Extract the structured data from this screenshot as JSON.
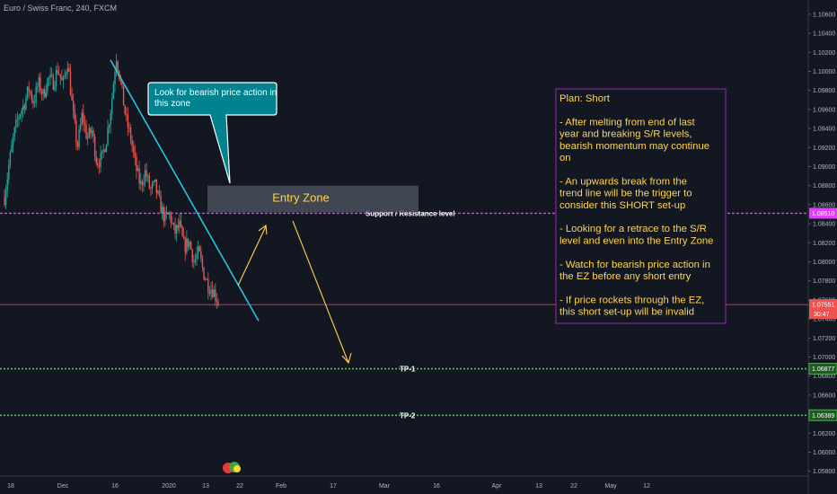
{
  "title": "Euro / Swiss Franc, 240, FXCM",
  "chart_data": {
    "type": "candlestick",
    "instrument": "Euro / Swiss Franc",
    "timeframe": "240",
    "broker": "FXCM",
    "ylim": [
      1.0575,
      1.1075
    ],
    "y_ticks": [
      "1.10600",
      "1.10400",
      "1.10200",
      "1.10000",
      "1.09800",
      "1.09600",
      "1.09400",
      "1.09200",
      "1.09000",
      "1.08800",
      "1.08600",
      "1.08400",
      "1.08200",
      "1.08000",
      "1.07800",
      "1.07600",
      "1.07400",
      "1.07200",
      "1.07000",
      "1.06800",
      "1.06600",
      "1.06400",
      "1.06200",
      "1.06000",
      "1.05800"
    ],
    "x_ticks": [
      "18",
      "Dec",
      "16",
      "2020",
      "13",
      "22",
      "Feb",
      "17",
      "Mar",
      "16",
      "Apr",
      "13",
      "22",
      "May",
      "12"
    ],
    "last_price": {
      "value": "1.07551",
      "countdown": "30:47"
    },
    "price_path": [
      1.0868,
      1.0905,
      1.0935,
      1.0955,
      1.0965,
      1.0982,
      1.0968,
      1.0988,
      1.0975,
      1.0993,
      1.0988,
      1.1003,
      1.0985,
      1.1011,
      1.096,
      1.092,
      1.0955,
      1.093,
      1.0938,
      1.0905,
      1.0908,
      1.093,
      1.0965,
      1.1017,
      1.0985,
      1.095,
      1.093,
      1.09,
      1.088,
      1.0895,
      1.0875,
      1.088,
      1.086,
      1.0845,
      1.085,
      1.083,
      1.0838,
      1.0815,
      1.0822,
      1.08,
      1.081,
      1.0788,
      1.0775,
      1.077,
      1.0758
    ],
    "levels": [
      {
        "name": "Support / Resistance level",
        "value": "1.08510",
        "color": "#e040fb",
        "style": "dashed"
      },
      {
        "name": "TP-1",
        "value": "1.06877",
        "color": "#66bb6a",
        "style": "dotted"
      },
      {
        "name": "TP-2",
        "value": "1.06389",
        "color": "#66bb6a",
        "style": "dotted"
      }
    ],
    "entry_zone": {
      "label": "Entry Zone",
      "from": 1.0852,
      "to": 1.088
    },
    "trendline": {
      "color": "#26c6da",
      "from": {
        "x": "16 Dec",
        "y": 1.1012
      },
      "to": {
        "x": "22 Jan",
        "y": 1.0738
      }
    },
    "colors": {
      "background": "#131722",
      "up": "#26a69a",
      "down": "#ef5350"
    }
  },
  "annotations": {
    "callout": {
      "lines": [
        "Look for bearish price action in",
        "this zone"
      ],
      "color": "#00838f"
    },
    "plan": {
      "lines": [
        "Plan: Short",
        "",
        "- After melting from end of last",
        "year and breaking S/R levels,",
        "bearish momentum may continue",
        "on",
        "",
        "- An upwards break from the",
        "trend line will be the trigger to",
        "consider this SHORT set-up",
        "",
        "- Looking for a retrace to the S/R",
        "level and even into the Entry Zone",
        "",
        "- Watch for bearish price action in",
        "the EZ before any short entry",
        "",
        "- If price rockets through the EZ,",
        "this short set-up will be invalid"
      ],
      "border_color": "#9c27b0",
      "text_color": "#ffd54f"
    },
    "arrow_color": "#ffd54f"
  }
}
